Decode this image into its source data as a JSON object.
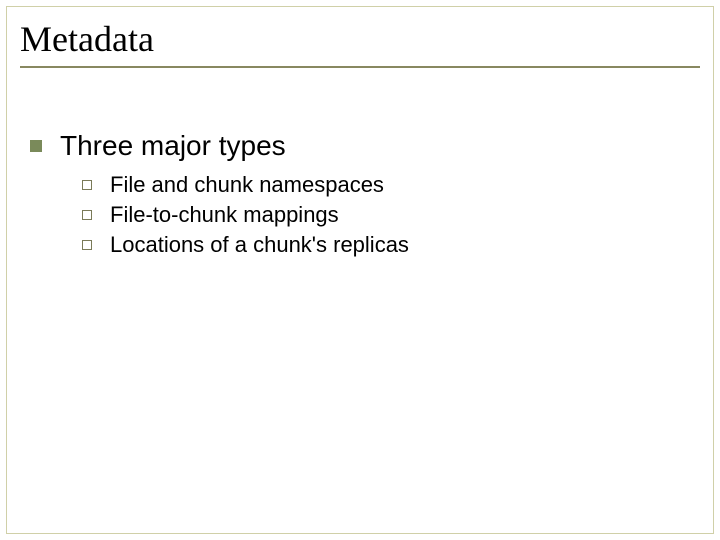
{
  "slide": {
    "title": "Metadata",
    "main_point": "Three major types",
    "sub_points": [
      "File and chunk namespaces",
      "File-to-chunk mappings",
      "Locations of a chunk's replicas"
    ]
  }
}
